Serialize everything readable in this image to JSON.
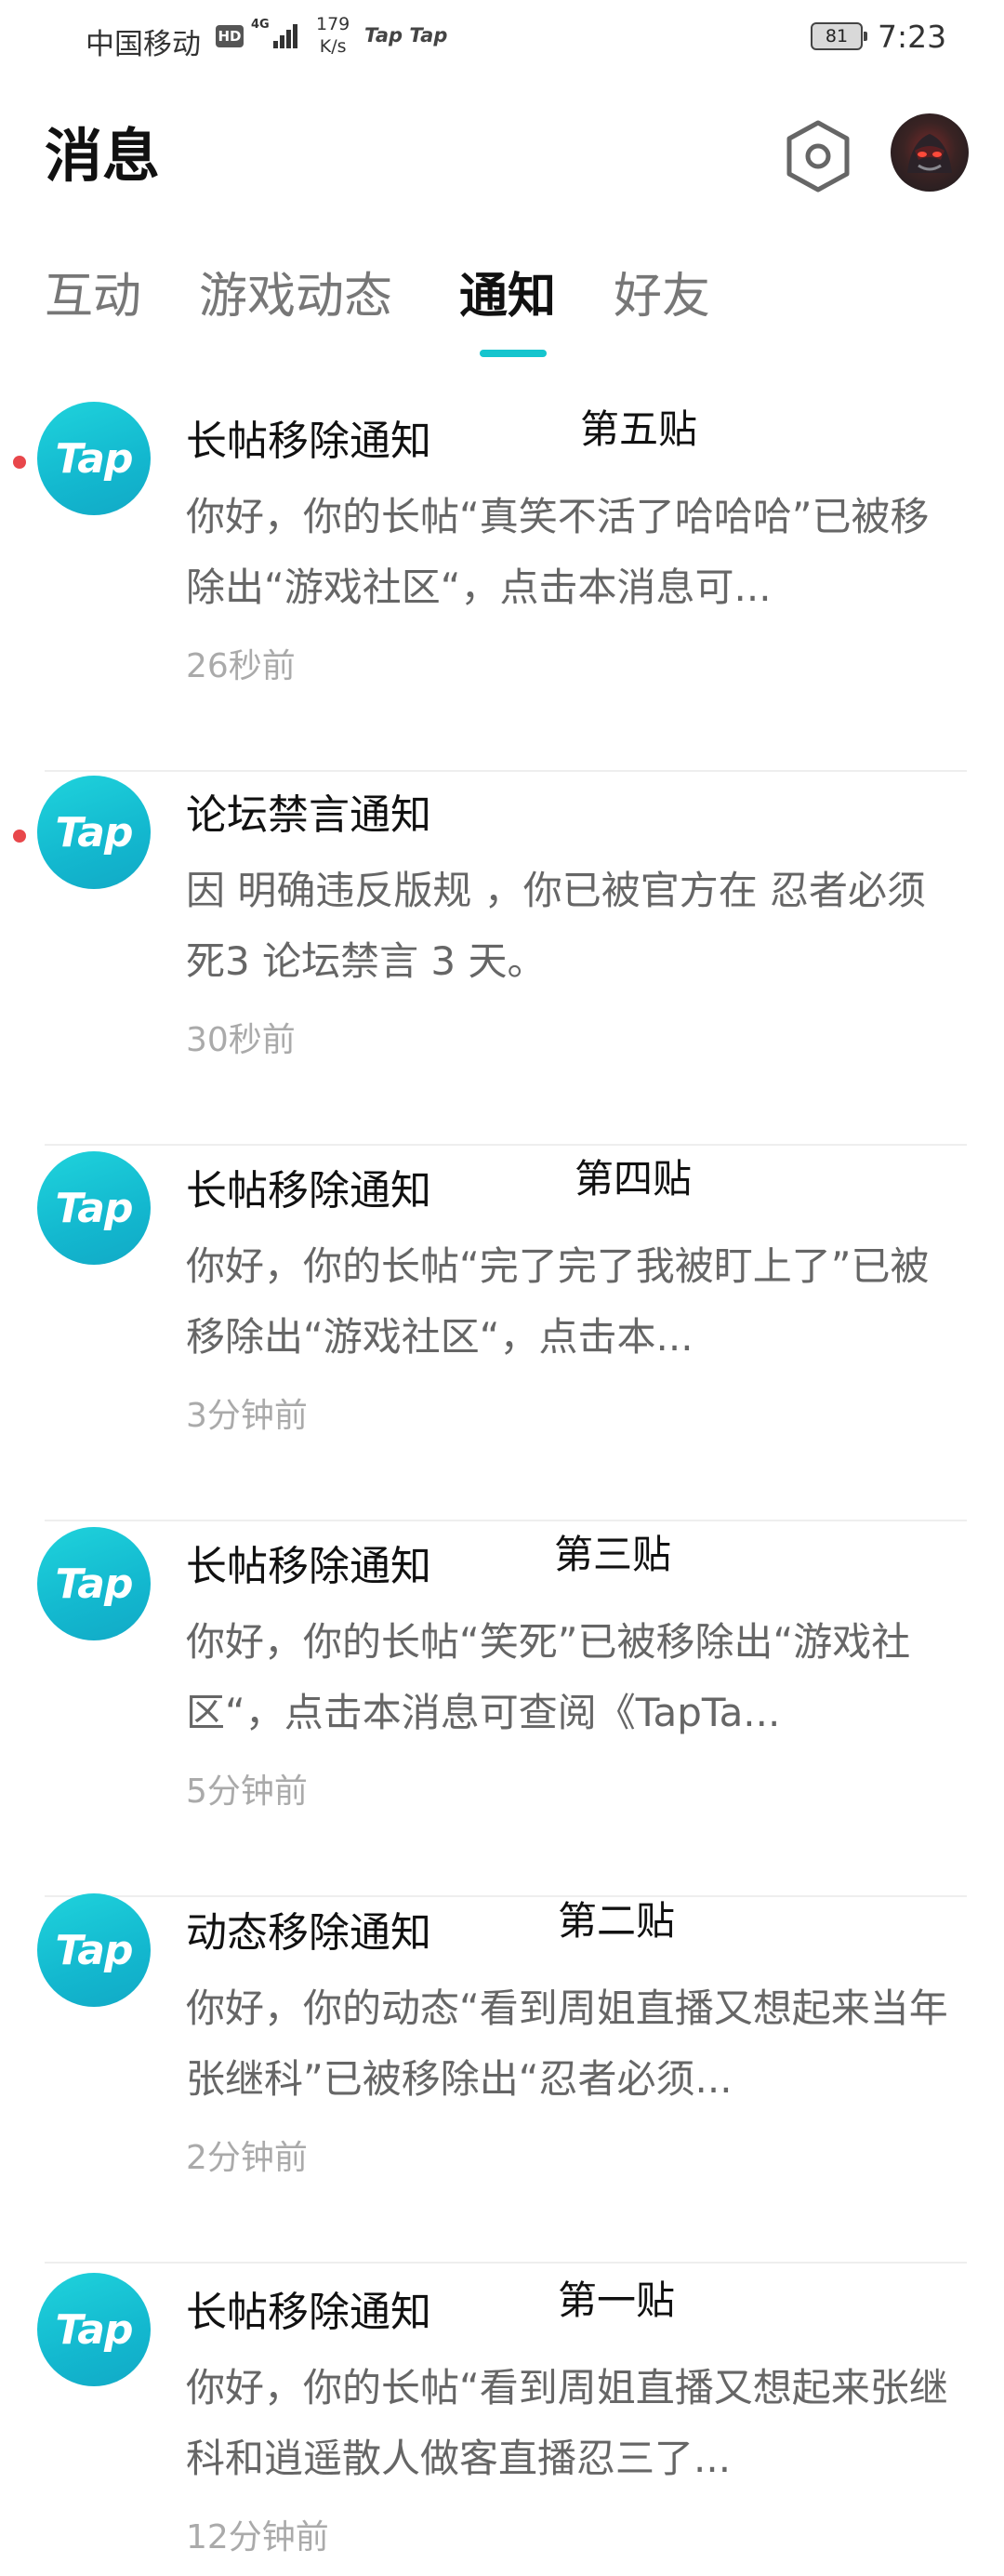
{
  "status_bar": {
    "carrier": "中国移动",
    "hd": "HD",
    "network": "4G",
    "speed_value": "179",
    "speed_unit": "K/s",
    "apps": "Tap Tap",
    "battery": "81",
    "time": "7:23"
  },
  "header": {
    "title": "消息",
    "settings_icon": "hexagon-settings-icon"
  },
  "tabs": [
    {
      "label": "互动",
      "active": false
    },
    {
      "label": "游戏动态",
      "active": false
    },
    {
      "label": "通知",
      "active": true
    },
    {
      "label": "好友",
      "active": false
    }
  ],
  "accent_color": "#15c5ce",
  "unread_color": "#e8474b",
  "notifications": [
    {
      "logo": "Tap",
      "title": "长帖移除通知",
      "annotation": "第五贴",
      "body": "你好，你的长帖“真笑不活了哈哈哈”已被移除出“游戏社区“，点击本消息可...",
      "time": "26秒前",
      "unread": true
    },
    {
      "logo": "Tap",
      "title": "论坛禁言通知",
      "annotation": "",
      "body": "因 明确违反版规 ，你已被官方在 忍者必须死3 论坛禁言 3 天。",
      "time": "30秒前",
      "unread": true
    },
    {
      "logo": "Tap",
      "title": "长帖移除通知",
      "annotation": "第四贴",
      "body": "你好，你的长帖“完了完了我被盯上了”已被移除出“游戏社区“，点击本...",
      "time": "3分钟前",
      "unread": false
    },
    {
      "logo": "Tap",
      "title": "长帖移除通知",
      "annotation": "第三贴",
      "body": "你好，你的长帖“笑死”已被移除出“游戏社区“，点击本消息可查阅《TapTa...",
      "time": "5分钟前",
      "unread": false
    },
    {
      "logo": "Tap",
      "title": "动态移除通知",
      "annotation": "第二贴",
      "body": "你好，你的动态“看到周姐直播又想起来当年张继科”已被移除出“忍者必须...",
      "time": "2分钟前",
      "unread": false
    },
    {
      "logo": "Tap",
      "title": "长帖移除通知",
      "annotation": "第一贴",
      "body": "你好，你的长帖“看到周姐直播又想起来张继科和逍遥散人做客直播忍三了...",
      "time": "12分钟前",
      "unread": false
    }
  ]
}
